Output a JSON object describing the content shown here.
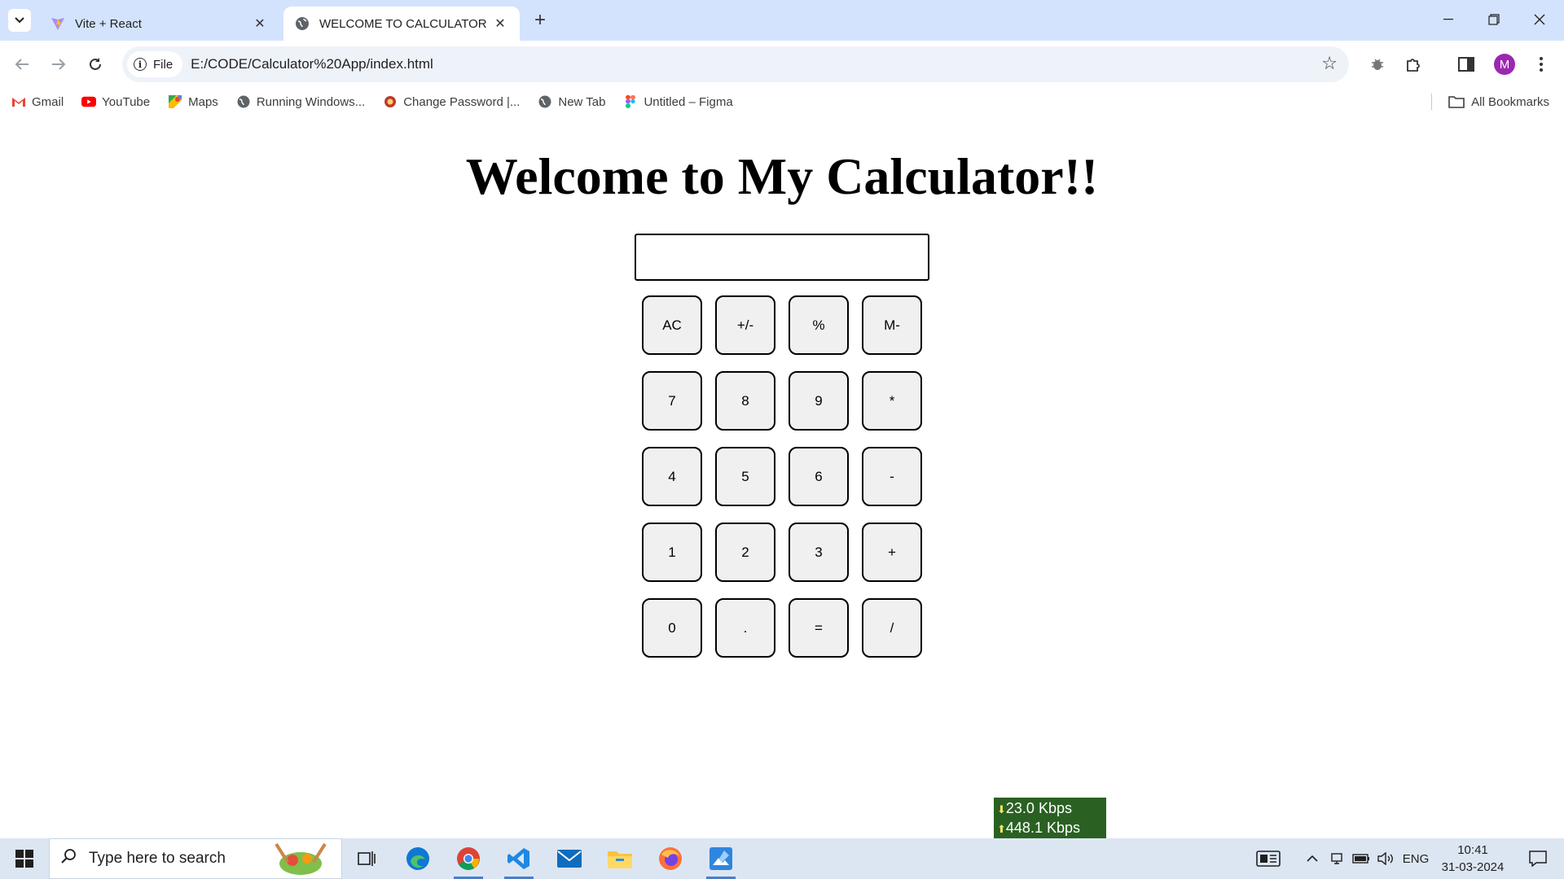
{
  "browser": {
    "tabs": [
      {
        "title": "Vite + React",
        "active": false,
        "icon": "vite-icon"
      },
      {
        "title": "WELCOME TO CALCULATOR",
        "active": true,
        "icon": "globe-icon"
      }
    ],
    "address": {
      "scheme_chip": "File",
      "url": "E:/CODE/Calculator%20App/index.html"
    },
    "profile_initial": "M",
    "bookmarks": [
      {
        "label": "Gmail",
        "icon": "gmail-icon"
      },
      {
        "label": "YouTube",
        "icon": "youtube-icon"
      },
      {
        "label": "Maps",
        "icon": "maps-icon"
      },
      {
        "label": "Running Windows...",
        "icon": "globe-icon"
      },
      {
        "label": "Change Password |...",
        "icon": "badge-icon"
      },
      {
        "label": "New Tab",
        "icon": "globe-icon"
      },
      {
        "label": "Untitled – Figma",
        "icon": "figma-icon"
      }
    ],
    "all_bookmarks": "All Bookmarks"
  },
  "page": {
    "title": "Welcome to My Calculator!!",
    "display_value": "",
    "keys": [
      "AC",
      "+/-",
      "%",
      "M-",
      "7",
      "8",
      "9",
      "*",
      "4",
      "5",
      "6",
      "-",
      "1",
      "2",
      "3",
      "+",
      "0",
      ".",
      "=",
      "/"
    ]
  },
  "netspeed": {
    "down": "23.0 Kbps",
    "up": "448.1 Kbps"
  },
  "taskbar": {
    "search_placeholder": "Type here to search",
    "lang": "ENG",
    "time": "10:41",
    "date": "31-03-2024"
  },
  "colors": {
    "tabstrip": "#d3e3fd",
    "omnibox": "#eef2f9",
    "key_bg": "#f0f0f0",
    "taskbar": "#dce6f2",
    "netspeed": "#2a6123",
    "avatar": "#9c27b0"
  }
}
